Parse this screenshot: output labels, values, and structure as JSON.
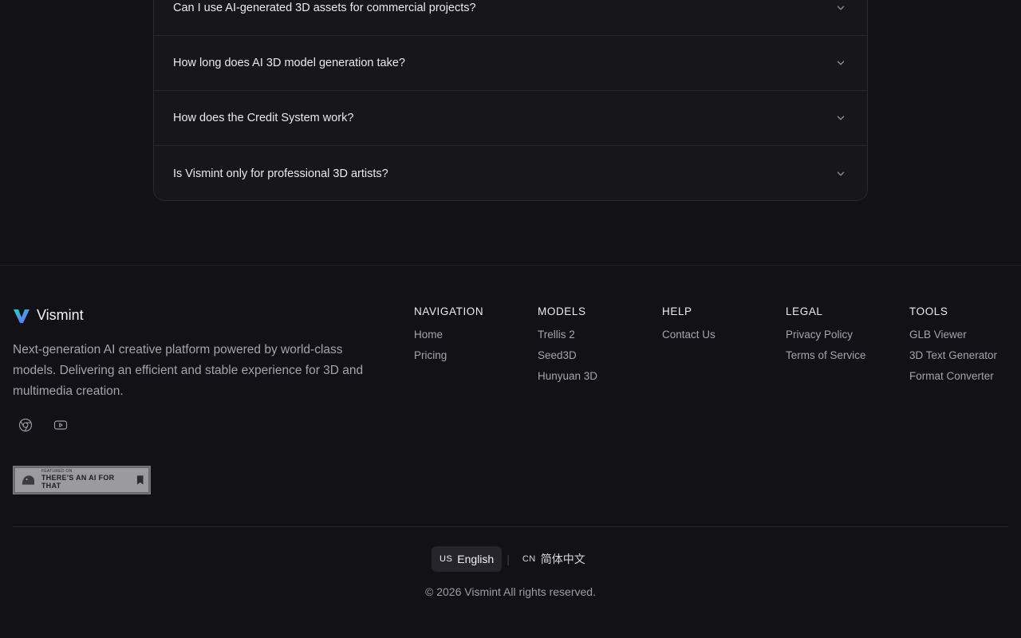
{
  "faq": {
    "items": [
      {
        "question": "Can I use AI-generated 3D assets for commercial projects?"
      },
      {
        "question": "How long does AI 3D model generation take?"
      },
      {
        "question": "How does the Credit System work?"
      },
      {
        "question": "Is Vismint only for professional 3D artists?"
      }
    ]
  },
  "brand": {
    "name": "Vismint",
    "description": "Next-generation AI creative platform powered by world-class models. Delivering an efficient and stable experience for 3D and multimedia creation."
  },
  "badge": {
    "small_text": "FEATURED ON",
    "text": "THERE'S AN AI FOR THAT"
  },
  "footer": {
    "columns": [
      {
        "title": "NAVIGATION",
        "links": [
          "Home",
          "Pricing"
        ]
      },
      {
        "title": "MODELS",
        "links": [
          "Trellis 2",
          "Seed3D",
          "Hunyuan 3D"
        ]
      },
      {
        "title": "HELP",
        "links": [
          "Contact Us"
        ]
      },
      {
        "title": "LEGAL",
        "links": [
          "Privacy Policy",
          "Terms of Service"
        ]
      },
      {
        "title": "TOOLS",
        "links": [
          "GLB Viewer",
          "3D Text Generator",
          "Format Converter"
        ]
      }
    ],
    "languages": [
      {
        "code": "US",
        "label": "English"
      },
      {
        "code": "CN",
        "label": "简体中文"
      }
    ],
    "copyright": "© 2026 Vismint All rights reserved."
  },
  "colors": {
    "background": "#111116",
    "logo_start": "#22d3c5",
    "logo_end": "#7b5cff"
  }
}
